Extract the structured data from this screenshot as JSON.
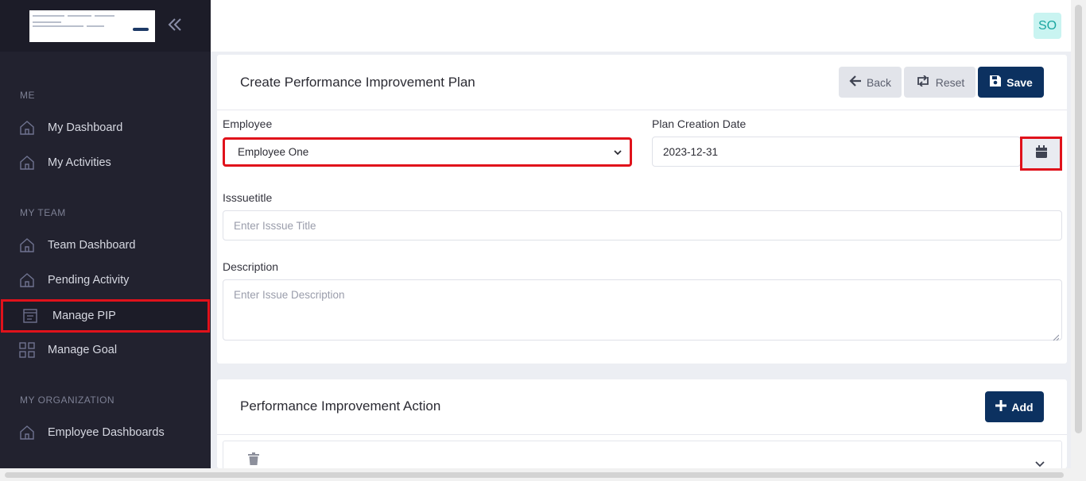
{
  "sidebar": {
    "collapse_icon": "double-chevron-left-icon",
    "sections": [
      {
        "title": "ME"
      },
      {
        "title": "MY TEAM"
      },
      {
        "title": "MY ORGANIZATION"
      }
    ],
    "items": [
      {
        "label": "My Dashboard",
        "icon": "home-icon"
      },
      {
        "label": "My Activities",
        "icon": "home-icon"
      },
      {
        "label": "Team Dashboard",
        "icon": "home-icon"
      },
      {
        "label": "Pending Activity",
        "icon": "home-icon"
      },
      {
        "label": "Manage PIP",
        "icon": "report-icon",
        "active": true
      },
      {
        "label": "Manage Goal",
        "icon": "grid-icon"
      },
      {
        "label": "Employee Dashboards",
        "icon": "home-icon"
      }
    ]
  },
  "header": {
    "avatar_initials": "SO"
  },
  "form": {
    "title": "Create Performance Improvement Plan",
    "back_label": "Back",
    "reset_label": "Reset",
    "save_label": "Save",
    "employee_label": "Employee",
    "employee_value": "Employee One",
    "plan_date_label": "Plan Creation Date",
    "plan_date_value": "2023-12-31",
    "issue_title_label": "Isssuetitle",
    "issue_title_placeholder": "Enter Isssue Title",
    "description_label": "Description",
    "description_placeholder": "Enter Issue Description"
  },
  "actions": {
    "title": "Performance Improvement Action",
    "add_label": "Add"
  },
  "colors": {
    "sidebar_bg": "#22222f",
    "primary": "#0c3160",
    "highlight": "#e0121b",
    "avatar_bg": "#c9f4f1",
    "avatar_text": "#1aa6a0"
  }
}
